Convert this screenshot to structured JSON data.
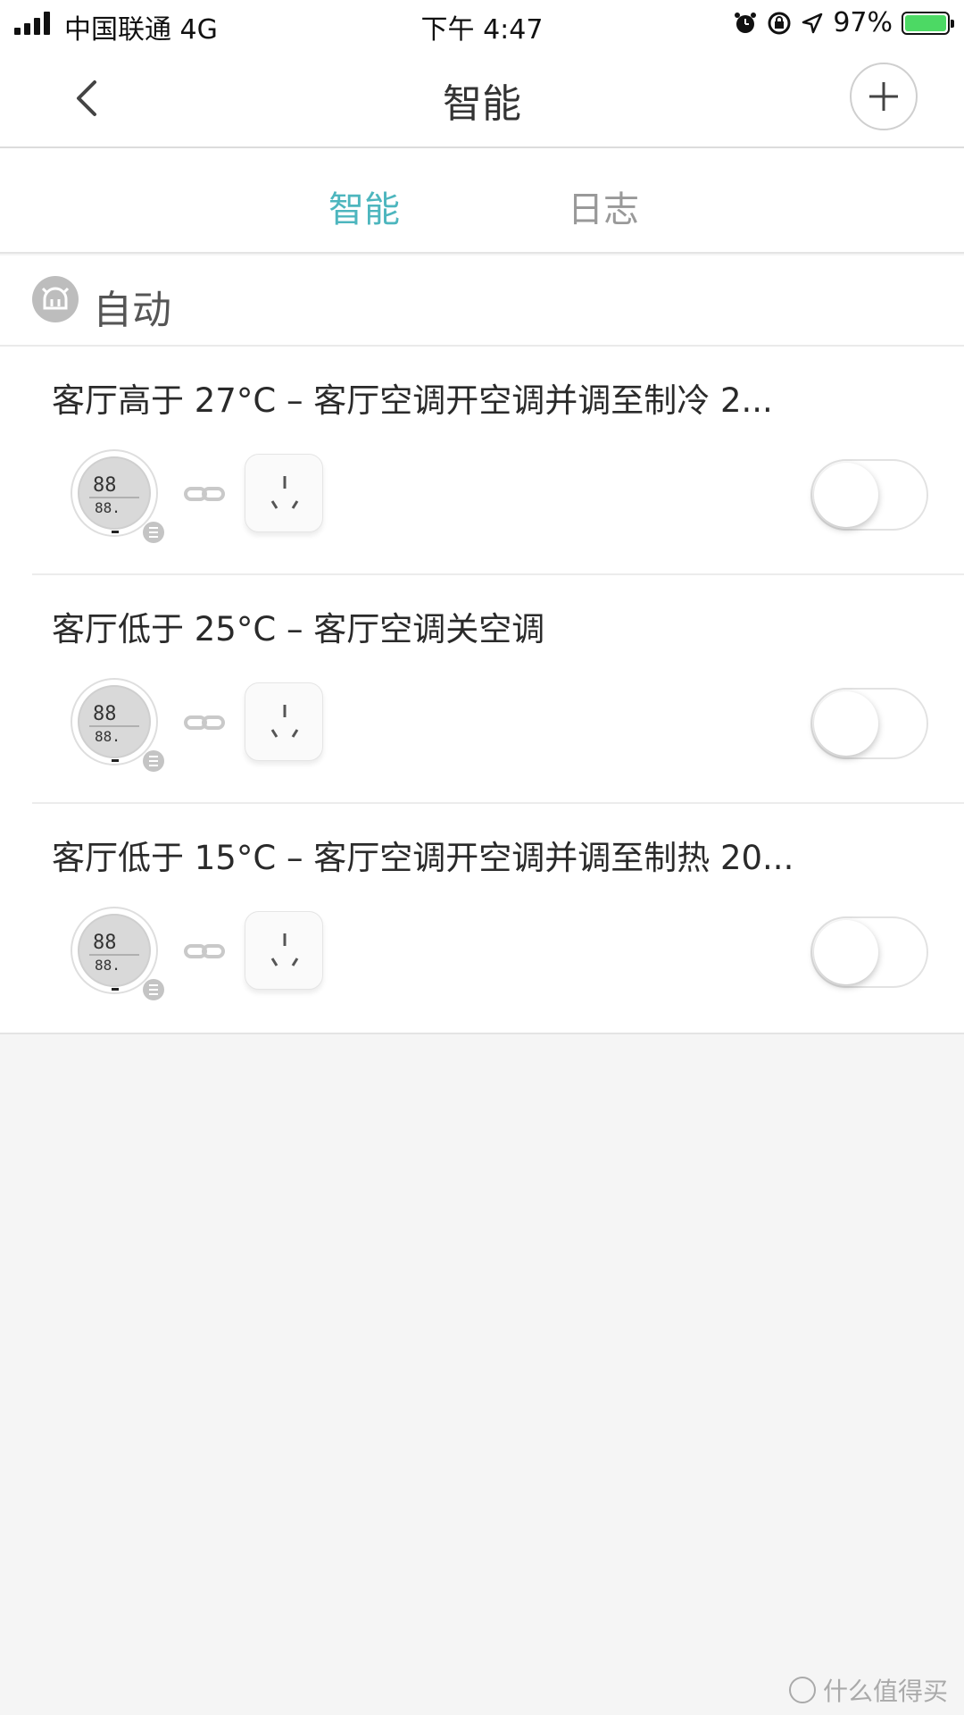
{
  "status_bar": {
    "carrier": "中国联通 4G",
    "time": "下午 4:47",
    "battery_percent": "97%",
    "icons": [
      "signal-icon",
      "alarm-icon",
      "rotation-lock-icon",
      "location-icon",
      "battery-icon"
    ]
  },
  "nav": {
    "title": "智能",
    "back_icon": "chevron-left-icon",
    "add_icon": "plus-icon"
  },
  "tabs": [
    {
      "label": "智能",
      "active": true
    },
    {
      "label": "日志",
      "active": false
    }
  ],
  "colors": {
    "accent": "#4db6be",
    "toggle_off": "#e2e2e2"
  },
  "section": {
    "label": "自动",
    "icon": "robot-icon"
  },
  "automations": [
    {
      "title": "客厅高于 27°C – 客厅空调开空调并调至制冷 2...",
      "enabled": false
    },
    {
      "title": "客厅低于 25°C – 客厅空调关空调",
      "enabled": false
    },
    {
      "title": "客厅低于 15°C – 客厅空调开空调并调至制热 20...",
      "enabled": false
    }
  ],
  "watermark": "什么值得买"
}
